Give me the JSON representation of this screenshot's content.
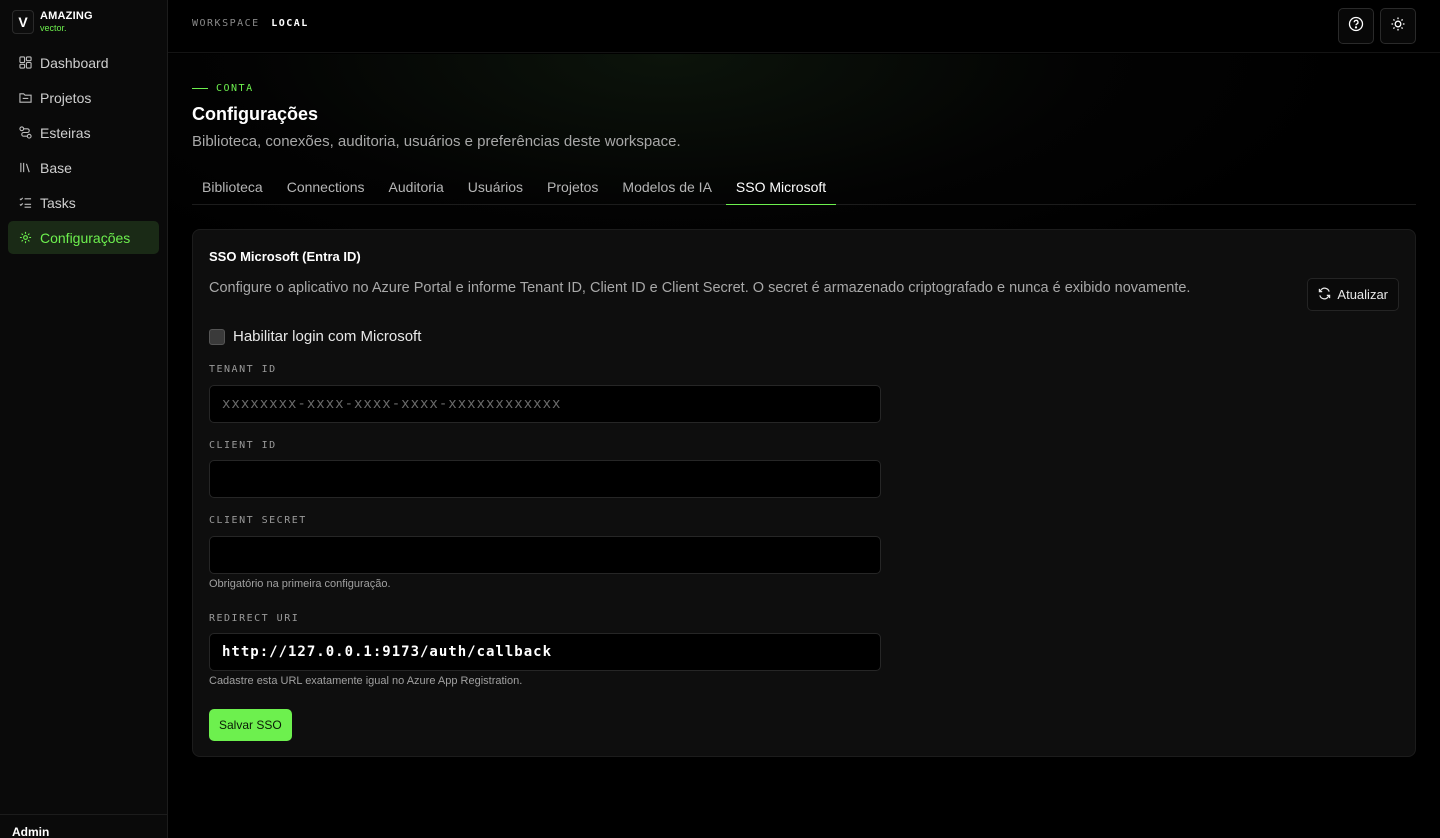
{
  "brand": {
    "logo_letter": "V",
    "name": "AMAZING",
    "sub": "vector."
  },
  "sidebar": {
    "items": [
      {
        "label": "Dashboard",
        "icon": "grid-icon",
        "active": false
      },
      {
        "label": "Projetos",
        "icon": "folder-icon",
        "active": false
      },
      {
        "label": "Esteiras",
        "icon": "route-icon",
        "active": false
      },
      {
        "label": "Base",
        "icon": "library-icon",
        "active": false
      },
      {
        "label": "Tasks",
        "icon": "list-checks-icon",
        "active": false
      },
      {
        "label": "Configurações",
        "icon": "gear-icon",
        "active": true
      }
    ],
    "footer_user": "Admin"
  },
  "topbar": {
    "workspace_label": "WORKSPACE",
    "workspace_value": "LOCAL",
    "help_icon": "help-circle-icon",
    "theme_icon": "sun-icon"
  },
  "page": {
    "section_tag": "CONTA",
    "title": "Configurações",
    "subtitle": "Biblioteca, conexões, auditoria, usuários e preferências deste workspace."
  },
  "tabs": [
    {
      "label": "Biblioteca",
      "active": false
    },
    {
      "label": "Connections",
      "active": false
    },
    {
      "label": "Auditoria",
      "active": false
    },
    {
      "label": "Usuários",
      "active": false
    },
    {
      "label": "Projetos",
      "active": false
    },
    {
      "label": "Modelos de IA",
      "active": false
    },
    {
      "label": "SSO Microsoft",
      "active": true
    }
  ],
  "sso": {
    "title": "SSO Microsoft (Entra ID)",
    "description": "Configure o aplicativo no Azure Portal e informe Tenant ID, Client ID e Client Secret. O secret é armazenado criptografado e nunca é exibido novamente.",
    "refresh_label": "Atualizar",
    "enable_label": "Habilitar login com Microsoft",
    "enable_checked": false,
    "tenant_label": "TENANT ID",
    "tenant_value": "",
    "tenant_placeholder": "xxxxxxxx-xxxx-xxxx-xxxx-xxxxxxxxxxxx",
    "client_id_label": "CLIENT ID",
    "client_id_value": "",
    "client_secret_label": "CLIENT SECRET",
    "client_secret_value": "",
    "client_secret_hint": "Obrigatório na primeira configuração.",
    "redirect_label": "REDIRECT URI",
    "redirect_value": "http://127.0.0.1:9173/auth/callback",
    "redirect_hint": "Cadastre esta URL exatamente igual no Azure App Registration.",
    "save_label": "Salvar SSO"
  },
  "colors": {
    "accent": "#6df04e",
    "background": "#000000",
    "card": "#0e0e0e"
  }
}
